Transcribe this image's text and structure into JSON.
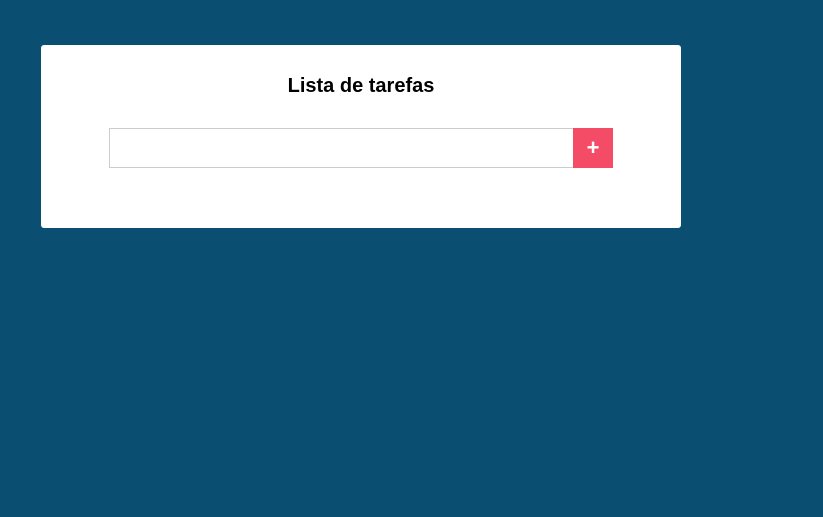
{
  "todo": {
    "title": "Lista de tarefas",
    "input": {
      "value": "",
      "placeholder": ""
    },
    "add_button": {
      "label": "+",
      "icon": "plus-icon"
    }
  },
  "colors": {
    "background": "#0a4f71",
    "card": "#ffffff",
    "accent": "#f44b67"
  }
}
